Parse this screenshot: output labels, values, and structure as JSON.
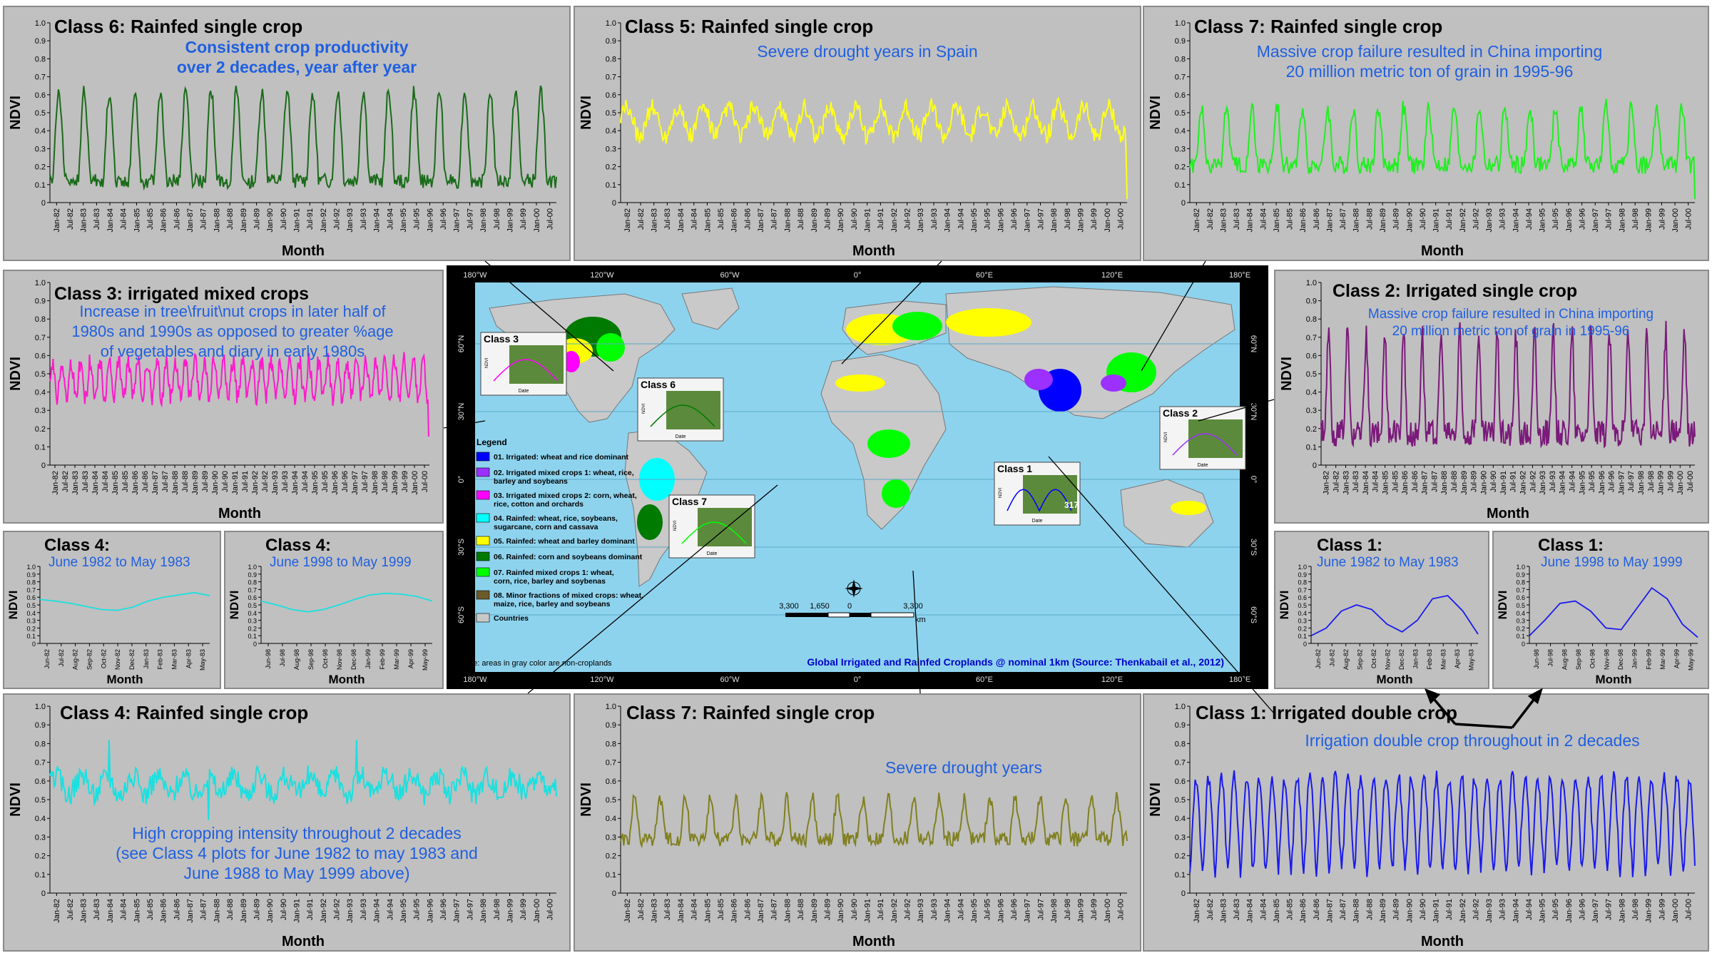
{
  "axis": {
    "ylabel": "NDVI",
    "xlabel": "Month",
    "yticks": [
      "0",
      "0.1",
      "0.2",
      "0.3",
      "0.4",
      "0.5",
      "0.6",
      "0.7",
      "0.8",
      "0.9",
      "1.0"
    ],
    "long_xticks": [
      "Jan-82",
      "Jul-82",
      "Jan-83",
      "Jul-83",
      "Jan-84",
      "Jul-84",
      "Jan-85",
      "Jul-85",
      "Jan-86",
      "Jul-86",
      "Jan-87",
      "Jul-87",
      "Jan-88",
      "Jul-88",
      "Jan-89",
      "Jul-89",
      "Jan-90",
      "Jul-90",
      "Jan-91",
      "Jul-91",
      "Jan-92",
      "Jul-92",
      "Jan-93",
      "Jul-93",
      "Jan-94",
      "Jul-94",
      "Jan-95",
      "Jul-95",
      "Jan-96",
      "Jul-96",
      "Jan-97",
      "Jul-97",
      "Jan-98",
      "Jul-98",
      "Jan-99",
      "Jul-99",
      "Jan-00",
      "Jul-00"
    ],
    "year_8283_xticks": [
      "Jun-82",
      "Jul-82",
      "Aug-82",
      "Sep-82",
      "Oct-82",
      "Nov-82",
      "Dec-82",
      "Jan-83",
      "Feb-83",
      "Mar-83",
      "Apr-83",
      "May-83"
    ],
    "year_9899_xticks": [
      "Jun-98",
      "Jul-98",
      "Aug-98",
      "Sep-98",
      "Oct-98",
      "Nov-98",
      "Dec-98",
      "Jan-99",
      "Feb-99",
      "Mar-99",
      "Apr-99",
      "May-99"
    ]
  },
  "panels": [
    {
      "id": "c6",
      "title": "Class 6: Rainfed single crop",
      "note": "Consistent crop productivity\nover 2 decades, year after year",
      "note_bold": true
    },
    {
      "id": "c5",
      "title": "Class 5: Rainfed single crop",
      "note": "Severe drought years in Spain"
    },
    {
      "id": "c7a",
      "title": "Class 7: Rainfed single crop",
      "note": "Massive crop failure resulted in China importing\n20 million metric ton of grain in 1995-96"
    },
    {
      "id": "c3",
      "title": "Class 3: irrigated mixed crops",
      "note": "Increase in tree\\fruit\\nut crops in later half of\n1980s and 1990s as opposed to greater %age\nof vegetables and diary in early 1980s"
    },
    {
      "id": "c2",
      "title": "Class 2: Irrigated single crop",
      "note": "Massive crop failure resulted in China importing\n20 million metric ton of grain in 1995-96"
    },
    {
      "id": "c4a",
      "title": "Class 4:",
      "note": "June 1982 to May 1983"
    },
    {
      "id": "c4b",
      "title": "Class 4:",
      "note": "June 1998 to May 1999"
    },
    {
      "id": "c1a",
      "title": "Class 1:",
      "note": "June 1982 to May 1983"
    },
    {
      "id": "c1b",
      "title": "Class 1:",
      "note": "June 1998 to May 1999"
    },
    {
      "id": "c4",
      "title": "Class 4: Rainfed single crop",
      "note": "High cropping intensity throughout 2 decades\n(see Class 4 plots for June 1982 to may 1983 and\nJune 1988 to May 1999 above)"
    },
    {
      "id": "c7b",
      "title": "Class 7: Rainfed single crop",
      "note": "Severe drought years"
    },
    {
      "id": "c1",
      "title": "Class 1: Irrigated double crop",
      "note": "Irrigation double crop throughout in 2 decades"
    }
  ],
  "chart_data": [
    {
      "type": "line",
      "id": "c6",
      "color": "#1a6b1a",
      "ylim": [
        0,
        1
      ],
      "x_range": [
        "Jan-82",
        "Dec-01"
      ],
      "series": [
        {
          "values": "seasonal NDVI, ~0.05 lows to ~0.60 peaks, one peak per year (1982-2001)"
        }
      ]
    },
    {
      "type": "line",
      "id": "c5",
      "color": "#ffff1a",
      "ylim": [
        0,
        1
      ],
      "x_range": [
        "Jan-82",
        "Dec-01"
      ],
      "series": [
        {
          "values": "~0.35-0.55, dips at Jan-85, Jan-92, Jul-95; drop to ~0.02 at end"
        }
      ]
    },
    {
      "type": "line",
      "id": "c7a",
      "color": "#22ee22",
      "ylim": [
        0,
        1
      ],
      "x_range": [
        "Jan-82",
        "Dec-01"
      ],
      "series": [
        {
          "values": "~0.15 lows to ~0.45-0.60 peaks, drop near Jan-95"
        }
      ]
    },
    {
      "type": "line",
      "id": "c3",
      "color": "#ff1acc",
      "ylim": [
        0,
        1
      ],
      "x_range": [
        "Jan-82",
        "Dec-01"
      ],
      "series": [
        {
          "values": "~0.35-0.60, ending drop to ~0.15"
        }
      ]
    },
    {
      "type": "line",
      "id": "c2",
      "color": "#7a1a7a",
      "ylim": [
        0,
        1
      ],
      "x_range": [
        "Jan-82",
        "Dec-01"
      ],
      "series": [
        {
          "values": "~0.10 lows to ~0.50-0.80 peaks, max ~0.96 near Jan-00"
        }
      ]
    },
    {
      "type": "line",
      "id": "c4a",
      "color": "#1ae0e0",
      "ylim": [
        0,
        1
      ],
      "categories": [
        "Jun-82",
        "Jul-82",
        "Aug-82",
        "Sep-82",
        "Oct-82",
        "Nov-82",
        "Dec-82",
        "Jan-83",
        "Feb-83",
        "Mar-83",
        "Apr-83",
        "May-83"
      ],
      "series": [
        {
          "values": [
            0.57,
            0.55,
            0.52,
            0.48,
            0.44,
            0.43,
            0.47,
            0.55,
            0.6,
            0.63,
            0.66,
            0.62
          ]
        }
      ]
    },
    {
      "type": "line",
      "id": "c4b",
      "color": "#1ae0e0",
      "ylim": [
        0,
        1
      ],
      "categories": [
        "Jun-98",
        "Jul-98",
        "Aug-98",
        "Sep-98",
        "Oct-98",
        "Nov-98",
        "Dec-98",
        "Jan-99",
        "Feb-99",
        "Mar-99",
        "Apr-99",
        "May-99"
      ],
      "series": [
        {
          "values": [
            0.55,
            0.5,
            0.44,
            0.41,
            0.44,
            0.5,
            0.57,
            0.63,
            0.65,
            0.64,
            0.61,
            0.55
          ]
        }
      ]
    },
    {
      "type": "line",
      "id": "c1a",
      "color": "#1a1aee",
      "ylim": [
        0,
        1
      ],
      "categories": [
        "Jun-82",
        "Jul-82",
        "Aug-82",
        "Sep-82",
        "Oct-82",
        "Nov-82",
        "Dec-82",
        "Jan-83",
        "Feb-83",
        "Mar-83",
        "Apr-83",
        "May-83"
      ],
      "series": [
        {
          "values": [
            0.1,
            0.2,
            0.42,
            0.5,
            0.44,
            0.25,
            0.15,
            0.3,
            0.58,
            0.62,
            0.42,
            0.12
          ]
        }
      ]
    },
    {
      "type": "line",
      "id": "c1b",
      "color": "#1a1aee",
      "ylim": [
        0,
        1
      ],
      "categories": [
        "Jun-98",
        "Jul-98",
        "Aug-98",
        "Sep-98",
        "Oct-98",
        "Nov-98",
        "Dec-98",
        "Jan-99",
        "Feb-99",
        "Mar-99",
        "Apr-99",
        "May-99"
      ],
      "series": [
        {
          "values": [
            0.1,
            0.3,
            0.52,
            0.55,
            0.42,
            0.2,
            0.18,
            0.45,
            0.72,
            0.58,
            0.25,
            0.08
          ]
        }
      ]
    },
    {
      "type": "line",
      "id": "c4",
      "color": "#1ae0e0",
      "ylim": [
        0,
        1
      ],
      "x_range": [
        "Jan-82",
        "Dec-01"
      ],
      "series": [
        {
          "values": "~0.50-0.70, spikes to ~0.82 at Jan-84 and Jan-94, dips ~0.40"
        }
      ]
    },
    {
      "type": "line",
      "id": "c7b",
      "color": "#808020",
      "ylim": [
        0,
        1
      ],
      "x_range": [
        "Jan-82",
        "Dec-01"
      ],
      "series": [
        {
          "values": "~0.20 lows to ~0.50 peaks, drought lows near Jan-89 and Jan-98"
        }
      ]
    },
    {
      "type": "line",
      "id": "c1",
      "color": "#1a1aee",
      "ylim": [
        0,
        1
      ],
      "x_range": [
        "Jan-82",
        "Dec-01"
      ],
      "series": [
        {
          "values": "two peaks per year, ~0.05 lows to ~0.65 peaks"
        }
      ]
    }
  ],
  "map": {
    "title": "Global Irrigated and Rainfed Croplands @ nominal 1km (Source: Thenkabail et al., 2012)",
    "note": "Note: areas in gray color are non-croplands",
    "top_lon": [
      "180°W",
      "120°W",
      "60°W",
      "0°",
      "60°E",
      "120°E",
      "180°E"
    ],
    "bottom_lon": [
      "180°W",
      "120°W",
      "60°W",
      "0°",
      "60°E",
      "120°E",
      "180°E"
    ],
    "left_lat": [
      "60°N",
      "30°N",
      "0°",
      "30°S",
      "60°S"
    ],
    "right_lat": [
      "60°N",
      "30°N",
      "0°",
      "30°S",
      "60°S"
    ],
    "legend_title": "Legend",
    "legend": [
      {
        "color": "#0000ff",
        "label": "01. Irrigated: wheat and rice dominant"
      },
      {
        "color": "#9b30ff",
        "label": "02. Irrigated mixed crops 1: wheat, rice,\nbarley and soybeans"
      },
      {
        "color": "#ff00ff",
        "label": "03. Irrigated mixed crops 2: corn, wheat,\nrice, cotton and orchards"
      },
      {
        "color": "#00ffff",
        "label": "04. Rainfed: wheat, rice, soybeans,\nsugarcane, corn and cassava"
      },
      {
        "color": "#ffff00",
        "label": "05. Rainfed: wheat and barley dominant"
      },
      {
        "color": "#007a00",
        "label": "06. Rainfed: corn and soybeans dominant"
      },
      {
        "color": "#00ff00",
        "label": "07. Rainfed mixed crops 1: wheat,\ncorn, rice, barley and soybenas"
      },
      {
        "color": "#6b5a2a",
        "label": "08. Minor fractions of mixed crops: wheat,\nmaize, rice, barley and soybeans"
      },
      {
        "color": "#c8c8c8",
        "label": "Countries"
      }
    ],
    "scale": [
      "3,300",
      "1,650",
      "0",
      "3,300"
    ],
    "scale_unit": "km",
    "insets": [
      "Class 3",
      "Class 6",
      "Class 2",
      "Class 7",
      "Class 1"
    ],
    "inset_axis": [
      "NDVI",
      "Date"
    ],
    "inset_number": "317"
  }
}
